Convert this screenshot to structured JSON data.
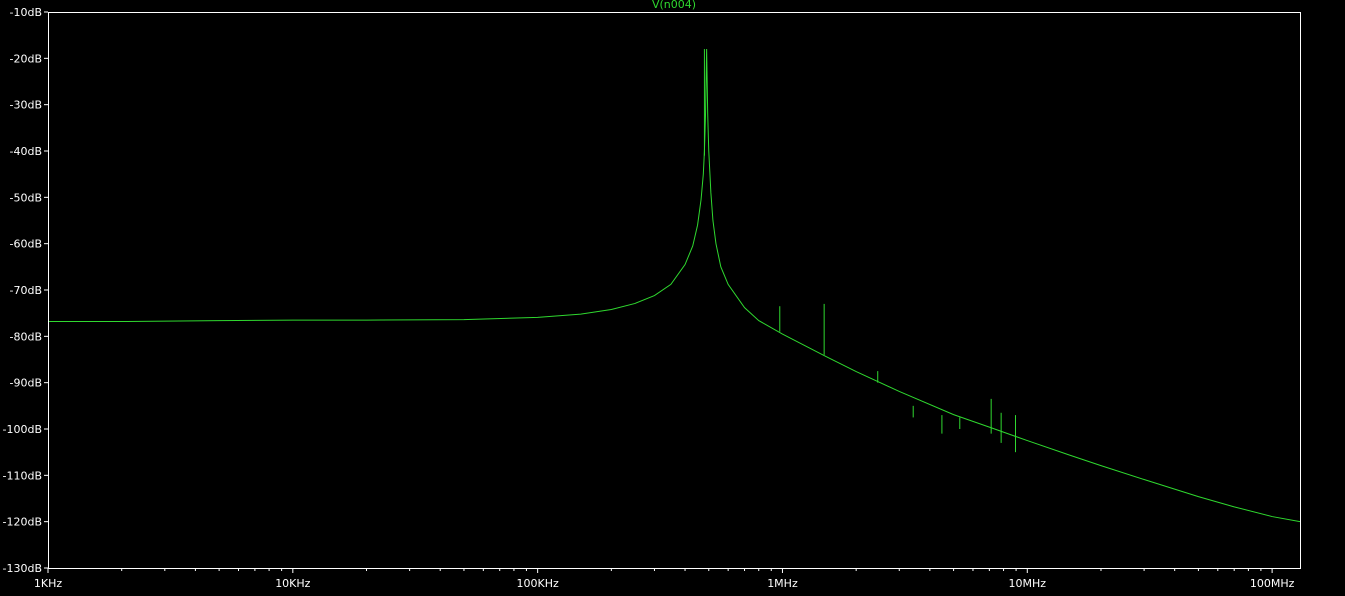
{
  "chart_data": {
    "type": "line",
    "title": "V(n004)",
    "xlabel": "",
    "ylabel": "",
    "x_scale": "log",
    "xlim": [
      1000,
      130000000
    ],
    "ylim": [
      -130,
      -10
    ],
    "grid": false,
    "colors": {
      "background": "#000000",
      "trace": "#2fd82f",
      "frame": "#ffffff",
      "text": "#ffffff"
    },
    "y_ticks": [
      -10,
      -20,
      -30,
      -40,
      -50,
      -60,
      -70,
      -80,
      -90,
      -100,
      -110,
      -120,
      -130
    ],
    "y_tick_labels": [
      "-10dB",
      "-20dB",
      "-30dB",
      "-40dB",
      "-50dB",
      "-60dB",
      "-70dB",
      "-80dB",
      "-90dB",
      "-100dB",
      "-110dB",
      "-120dB",
      "-130dB"
    ],
    "x_ticks": [
      1000,
      10000,
      100000,
      1000000,
      10000000,
      100000000
    ],
    "x_tick_labels": [
      "1KHz",
      "10KHz",
      "100KHz",
      "1MHz",
      "10MHz",
      "100MHz"
    ],
    "series": [
      {
        "name": "V(n004)",
        "color": "#2fd82f",
        "x": [
          1000,
          2000,
          5000,
          10000,
          20000,
          50000,
          100000,
          150000,
          200000,
          250000,
          300000,
          350000,
          400000,
          430000,
          450000,
          465000,
          475000,
          480000,
          485000,
          490000,
          495000,
          500000,
          505000,
          510000,
          520000,
          535000,
          560000,
          600000,
          700000,
          800000,
          1000000,
          1500000,
          2000000,
          3000000,
          5000000,
          7000000,
          10000000,
          15000000,
          20000000,
          30000000,
          50000000,
          70000000,
          100000000,
          130000000
        ],
        "y": [
          -76.8,
          -76.8,
          -76.6,
          -76.5,
          -76.5,
          -76.4,
          -75.9,
          -75.2,
          -74.2,
          -72.9,
          -71.2,
          -68.8,
          -64.5,
          -60.5,
          -56.0,
          -50.5,
          -45.0,
          -40.0,
          -32.0,
          -18.0,
          -32.0,
          -40.0,
          -44.5,
          -49.0,
          -55.0,
          -60.0,
          -65.0,
          -68.8,
          -73.8,
          -76.6,
          -79.5,
          -84.3,
          -87.6,
          -91.9,
          -96.9,
          -99.6,
          -102.5,
          -105.7,
          -107.9,
          -110.9,
          -114.6,
          -116.8,
          -118.9,
          -120.0
        ]
      }
    ],
    "spikes": [
      {
        "x": 480000,
        "y_top": -18,
        "y_bottom": -41
      },
      {
        "x": 975000,
        "y_top": -73.5,
        "y_bottom": -79
      },
      {
        "x": 1480000,
        "y_top": -73,
        "y_bottom": -84
      },
      {
        "x": 2450000,
        "y_top": -87.5,
        "y_bottom": -90
      },
      {
        "x": 3420000,
        "y_top": -95,
        "y_bottom": -97.5
      },
      {
        "x": 4480000,
        "y_top": -97,
        "y_bottom": -101
      },
      {
        "x": 5300000,
        "y_top": -97.5,
        "y_bottom": -100
      },
      {
        "x": 7120000,
        "y_top": -93.5,
        "y_bottom": -101
      },
      {
        "x": 7820000,
        "y_top": -96.5,
        "y_bottom": -103
      },
      {
        "x": 8950000,
        "y_top": -97,
        "y_bottom": -105
      }
    ]
  }
}
